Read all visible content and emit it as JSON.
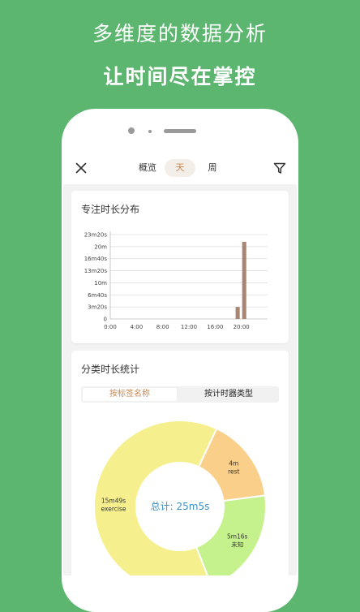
{
  "promo": {
    "line1": "多维度的数据分析",
    "line2": "让时间尽在掌控"
  },
  "topbar": {
    "tabs": [
      "概览",
      "天",
      "周"
    ],
    "active_tab": "天"
  },
  "focus_card": {
    "title": "专注时长分布",
    "chart_data": {
      "type": "bar",
      "title": "专注时长分布",
      "x_tick_labels": [
        "0:00",
        "4:00",
        "8:00",
        "12:00",
        "16:00",
        "20:00"
      ],
      "y_tick_labels": [
        "0",
        "3m20s",
        "6m40s",
        "10m",
        "13m20s",
        "16m40s",
        "20m",
        "23m20s"
      ],
      "y_unit": "seconds",
      "ylim": [
        0,
        1400
      ],
      "x_unit": "hour of day",
      "xlim": [
        0,
        24
      ],
      "bars": [
        {
          "hour": 19,
          "value": 200
        },
        {
          "hour": 20,
          "value": 1280
        }
      ],
      "bar_color": "#a98672",
      "grid": true
    }
  },
  "category_card": {
    "title": "分类时长统计",
    "toggle": {
      "by_tag": "按标签名称",
      "by_timer_type": "按计时器类型",
      "active": "按标签名称"
    },
    "chart_data": {
      "type": "pie",
      "total_label": "总计: 25m5s",
      "slices": [
        {
          "label": "exercise",
          "duration": "15m49s",
          "value": 949,
          "color": "#f6ef8d"
        },
        {
          "label": "rest",
          "duration": "4m",
          "value": 240,
          "color": "#f9cf8a"
        },
        {
          "label": "未知",
          "duration": "5m16s",
          "value": 316,
          "color": "#c6f28d"
        }
      ]
    }
  }
}
